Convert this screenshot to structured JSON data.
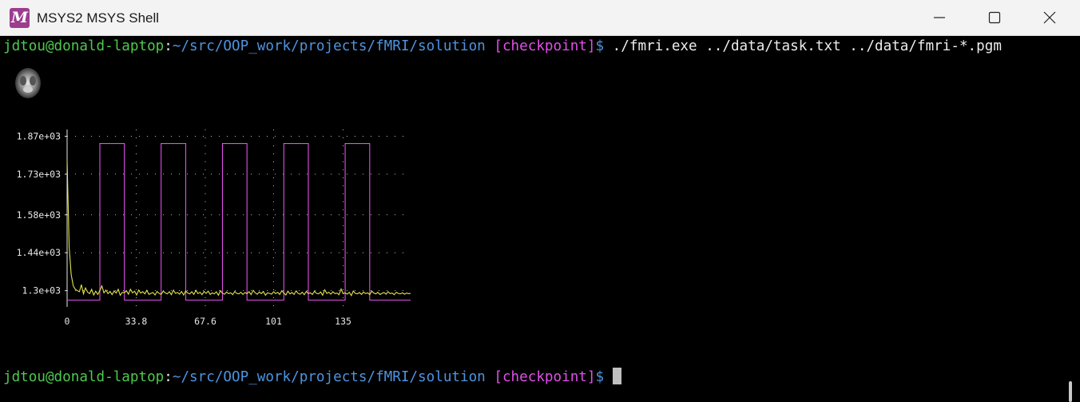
{
  "window": {
    "title": "MSYS2 MSYS Shell",
    "icon_glyph": "M",
    "icon_color": "#9c3d8e",
    "controls": [
      "minimize-icon",
      "maximize-icon",
      "close-icon"
    ]
  },
  "terminal": {
    "prompt1": {
      "user": "jdtou@donald-laptop",
      "sep": ":",
      "path": "~/src/OOP_work/projects/fMRI/solution",
      "branch": "[checkpoint]",
      "dollar": "$",
      "command": "./fmri.exe ../data/task.txt ../data/fmri-*.pgm"
    },
    "prompt2": {
      "user": "jdtou@donald-laptop",
      "sep": ":",
      "path": "~/src/OOP_work/projects/fMRI/solution",
      "branch": "[checkpoint]",
      "dollar": "$"
    },
    "colors": {
      "user": "#4ec94e",
      "path": "#4d94e0",
      "branch": "#e14fe8",
      "text": "#ececec"
    }
  },
  "chart_data": {
    "type": "line",
    "title": "",
    "xlabel": "",
    "ylabel": "",
    "xlim": [
      0,
      168
    ],
    "ylim": [
      1240,
      1895
    ],
    "grid": true,
    "x_ticks": [
      {
        "v": 0,
        "label": "0"
      },
      {
        "v": 33.8,
        "label": "33.8"
      },
      {
        "v": 67.6,
        "label": "67.6"
      },
      {
        "v": 101,
        "label": "101"
      },
      {
        "v": 135,
        "label": "135"
      }
    ],
    "y_ticks": [
      {
        "v": 1300,
        "label": "1.3e+03"
      },
      {
        "v": 1440,
        "label": "1.44e+03"
      },
      {
        "v": 1580,
        "label": "1.58e+03"
      },
      {
        "v": 1730,
        "label": "1.73e+03"
      },
      {
        "v": 1870,
        "label": "1.87e+03"
      }
    ],
    "series": [
      {
        "color": "#e14fe8",
        "style": "step",
        "x": [
          0,
          16,
          16,
          28,
          28,
          46,
          46,
          58,
          58,
          76,
          76,
          88,
          88,
          106,
          106,
          118,
          118,
          136,
          136,
          148,
          148,
          168
        ],
        "values": [
          1265,
          1265,
          1843,
          1843,
          1265,
          1265,
          1843,
          1843,
          1265,
          1265,
          1843,
          1843,
          1265,
          1265,
          1843,
          1843,
          1265,
          1265,
          1843,
          1843,
          1265,
          1265
        ]
      },
      {
        "color": "#e3e34a",
        "x": [
          0,
          1,
          2,
          3,
          4,
          5,
          6,
          7,
          8,
          9,
          10,
          11,
          12,
          13,
          14,
          15,
          16,
          17,
          18,
          19,
          20,
          21,
          22,
          23,
          24,
          25,
          26,
          27,
          28,
          29,
          30,
          31,
          32,
          33,
          34,
          35,
          36,
          37,
          38,
          39,
          40,
          41,
          42,
          43,
          44,
          45,
          46,
          47,
          48,
          49,
          50,
          51,
          52,
          53,
          54,
          55,
          56,
          57,
          58,
          59,
          60,
          61,
          62,
          63,
          64,
          65,
          66,
          67,
          68,
          69,
          70,
          71,
          72,
          73,
          74,
          75,
          76,
          77,
          78,
          79,
          80,
          81,
          82,
          83,
          84,
          85,
          86,
          87,
          88,
          89,
          90,
          91,
          92,
          93,
          94,
          95,
          96,
          97,
          98,
          99,
          100,
          101,
          102,
          103,
          104,
          105,
          106,
          107,
          108,
          109,
          110,
          111,
          112,
          113,
          114,
          115,
          116,
          117,
          118,
          119,
          120,
          121,
          122,
          123,
          124,
          125,
          126,
          127,
          128,
          129,
          130,
          131,
          132,
          133,
          134,
          135,
          136,
          137,
          138,
          139,
          140,
          141,
          142,
          143,
          144,
          145,
          146,
          147,
          148,
          149,
          150,
          151,
          152,
          153,
          154,
          155,
          156,
          157,
          158,
          159,
          160,
          161,
          162,
          163,
          164,
          165,
          166,
          167,
          168
        ],
        "values": [
          1780,
          1460,
          1360,
          1318,
          1305,
          1300,
          1296,
          1322,
          1288,
          1310,
          1295,
          1289,
          1305,
          1284,
          1298,
          1286,
          1300,
          1318,
          1292,
          1302,
          1289,
          1297,
          1285,
          1299,
          1291,
          1305,
          1283,
          1294,
          1292,
          1300,
          1287,
          1305,
          1292,
          1298,
          1284,
          1302,
          1291,
          1296,
          1288,
          1301,
          1286,
          1290,
          1293,
          1284,
          1297,
          1290,
          1286,
          1298,
          1292,
          1288,
          1296,
          1285,
          1302,
          1290,
          1293,
          1287,
          1297,
          1284,
          1299,
          1291,
          1288,
          1296,
          1286,
          1301,
          1289,
          1294,
          1285,
          1297,
          1290,
          1298,
          1286,
          1292,
          1288,
          1296,
          1283,
          1300,
          1290,
          1287,
          1295,
          1289,
          1292,
          1285,
          1297,
          1290,
          1288,
          1294,
          1286,
          1293,
          1289,
          1296,
          1285,
          1301,
          1292,
          1287,
          1295,
          1289,
          1297,
          1283,
          1292,
          1290,
          1287,
          1296,
          1289,
          1294,
          1286,
          1300,
          1291,
          1284,
          1298,
          1288,
          1293,
          1286,
          1299,
          1290,
          1287,
          1294,
          1285,
          1297,
          1289,
          1292,
          1286,
          1298,
          1290,
          1288,
          1295,
          1283,
          1303,
          1290,
          1294,
          1287,
          1296,
          1289,
          1291,
          1285,
          1306,
          1289,
          1292,
          1287,
          1294,
          1282,
          1299,
          1290,
          1288,
          1293,
          1286,
          1295,
          1289,
          1292,
          1285,
          1298,
          1291,
          1288,
          1294,
          1286,
          1290,
          1293,
          1287,
          1296,
          1289,
          1291,
          1285,
          1294,
          1290,
          1288,
          1292,
          1287,
          1291,
          1289,
          1290
        ]
      }
    ]
  }
}
